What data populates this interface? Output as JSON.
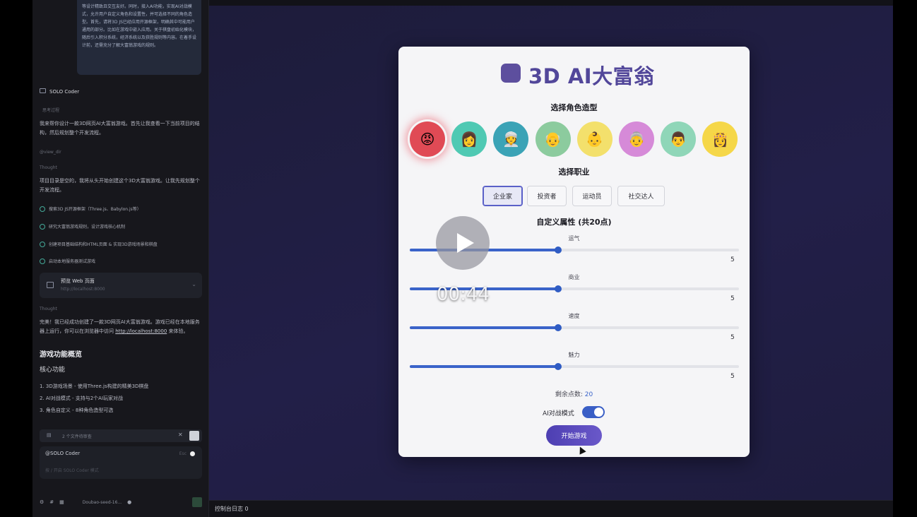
{
  "chat": {
    "bubble_text": "等设计精致且交互友好。同时，接入AI功能，实现AI对战模式，允许用户自定义角色和设置性，并可选择不同的角色造型。首先，请将3D JS已经应用开源框架，明确其中可能用户通用的部分。比如在游戏中嵌入应用。关于棋盘初始化模块，随后引入积分系统，经济系统以及获胜规则等内容。在着手设计前，还需充分了解大富翁游戏的规则。",
    "agent_name": "SOLO Coder",
    "tag": "思考过程",
    "intro": "我来帮你设计一款3D网页AI大富翁游戏。首先让我查看一下当前项目的结构，然后规划整个开发流程。",
    "tool_1": "@view_dir",
    "thought_1": "Thought",
    "para_2": "项目目录是空的，我将从头开始创建这个3D大富翁游戏。让我先规划整个开发流程。",
    "tasks": [
      "搜索3D JS开源框架（Three.js、Babylon.js等）",
      "研究大富翁游戏规则，设计游戏核心机制",
      "创建项目基础结构和HTML页面 & 实现3D游戏场景和棋盘",
      "启动本地服务器测试游戏"
    ],
    "preview_title": "预览 Web 页面",
    "preview_url": "http://localhost:8000",
    "thought_2": "Thought",
    "done_text": "完美！我已经成功创建了一款3D网页AI大富翁游戏。游戏已经在本地服务器上运行，你可以在浏览器中访问",
    "done_link": "http://localhost:8000",
    "done_tail": "来体验。",
    "overview_title": "游戏功能概览",
    "core_title": "核心功能",
    "features": [
      "1. 3D游戏场景 - 使用Three.js构建的精美3D棋盘",
      "2. AI对战模式 - 支持与2个AI玩家对战",
      "3. 角色自定义 - 8种角色造型可选"
    ],
    "files_changed": "2 个文件待审查",
    "composer_agent": "@SOLO Coder",
    "composer_hint": "Esc",
    "composer_placeholder": "按 / 开启 SOLO Coder 模式",
    "model_label": "Doubao-seed-16..."
  },
  "console": {
    "label": "控制台日志  0"
  },
  "game": {
    "title": "3D AI大富翁",
    "avatar_heading": "选择角色造型",
    "avatars": [
      {
        "emoji": "😡",
        "color": "#e04a55",
        "selected": true
      },
      {
        "emoji": "👩",
        "color": "#4fc9b3",
        "selected": false
      },
      {
        "emoji": "👳",
        "color": "#3ba3b6",
        "selected": false
      },
      {
        "emoji": "👴",
        "color": "#8ccb9e",
        "selected": false
      },
      {
        "emoji": "👶",
        "color": "#f3e06c",
        "selected": false
      },
      {
        "emoji": "👵",
        "color": "#d68ad8",
        "selected": false
      },
      {
        "emoji": "👨",
        "color": "#8fd6b8",
        "selected": false
      },
      {
        "emoji": "👸",
        "color": "#f5d749",
        "selected": false
      }
    ],
    "job_heading": "选择职业",
    "jobs": [
      {
        "label": "企业家",
        "selected": true
      },
      {
        "label": "投资者",
        "selected": false
      },
      {
        "label": "运动员",
        "selected": false
      },
      {
        "label": "社交达人",
        "selected": false
      }
    ],
    "attr_heading": "自定义属性 (共20点)",
    "attributes": [
      {
        "label": "运气",
        "value": 5,
        "max": 10
      },
      {
        "label": "商业",
        "value": 5,
        "max": 10
      },
      {
        "label": "速度",
        "value": 5,
        "max": 10
      },
      {
        "label": "魅力",
        "value": 5,
        "max": 10
      }
    ],
    "remaining_label": "剩余点数:",
    "remaining_value": "20",
    "ai_mode_label": "AI对战模式",
    "ai_mode_on": true,
    "start_label": "开始游戏"
  },
  "video": {
    "time": "00:44"
  }
}
